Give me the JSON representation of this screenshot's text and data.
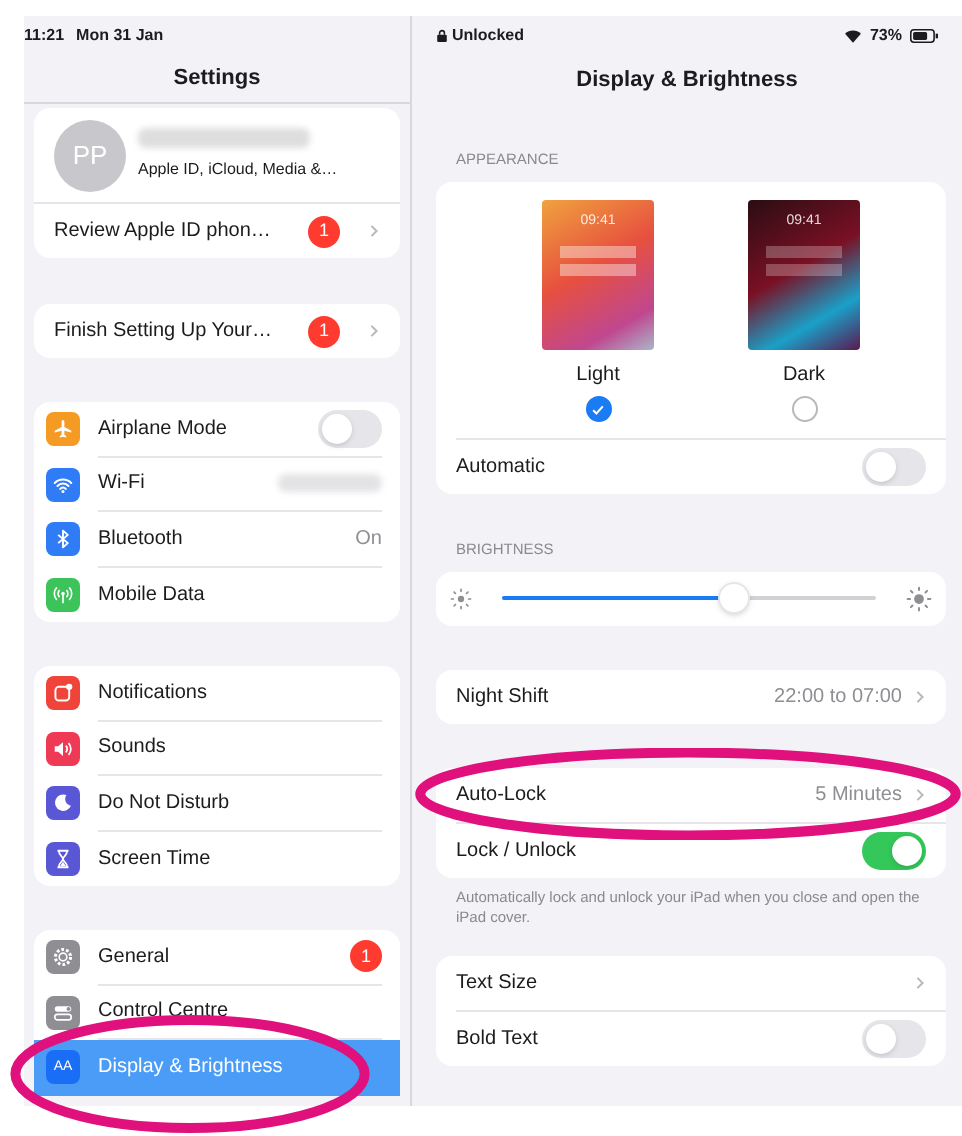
{
  "sidebar": {
    "status_time": "11:21",
    "status_date": "Mon 31 Jan",
    "title": "Settings",
    "profile": {
      "initials": "PP",
      "subtitle": "Apple ID, iCloud, Media &…",
      "alert": {
        "label": "Review Apple ID phon…",
        "badge": "1"
      }
    },
    "setup": {
      "label": "Finish Setting Up Your…",
      "badge": "1"
    },
    "groups": [
      [
        {
          "label": "Airplane Mode",
          "color": "#f59a23",
          "kind": "toggle",
          "on": false,
          "selected": false
        },
        {
          "label": "Wi-Fi",
          "color": "#2f7cf6",
          "kind": "hidden",
          "selected": false
        },
        {
          "label": "Bluetooth",
          "color": "#2f7cf6",
          "kind": "value",
          "value": "On",
          "selected": false
        },
        {
          "label": "Mobile Data",
          "color": "#3cc35a",
          "kind": "plain",
          "selected": false
        }
      ],
      [
        {
          "label": "Notifications",
          "color": "#f0433a",
          "kind": "plain",
          "selected": false
        },
        {
          "label": "Sounds",
          "color": "#ef3a55",
          "kind": "plain",
          "selected": false
        },
        {
          "label": "Do Not Disturb",
          "color": "#5a57d6",
          "kind": "plain",
          "selected": false
        },
        {
          "label": "Screen Time",
          "color": "#5a57d6",
          "kind": "plain",
          "selected": false
        }
      ],
      [
        {
          "label": "General",
          "color": "#8e8e93",
          "kind": "badge",
          "badge": "1",
          "selected": false
        },
        {
          "label": "Control Centre",
          "color": "#8e8e93",
          "kind": "plain",
          "selected": false
        },
        {
          "label": "Display & Brightness",
          "icon_text": "AA",
          "color": "#1a6ef5",
          "kind": "plain",
          "selected": true,
          "highlighted": true
        }
      ]
    ]
  },
  "detail": {
    "status_lock": "Unlocked",
    "battery_text": "73%",
    "title": "Display & Brightness",
    "appearance": {
      "header": "APPEARANCE",
      "options": [
        {
          "label": "Light",
          "time": "09:41",
          "selected": true
        },
        {
          "label": "Dark",
          "time": "09:41",
          "selected": false
        }
      ],
      "automatic": {
        "label": "Automatic",
        "on": false
      }
    },
    "brightness": {
      "header": "BRIGHTNESS",
      "level": 0.62
    },
    "groups": [
      {
        "rows": [
          {
            "label": "Night Shift",
            "kind": "value",
            "value": "22:00 to 07:00",
            "highlighted": false
          }
        ]
      },
      {
        "rows": [
          {
            "label": "Auto-Lock",
            "kind": "value",
            "value": "5 Minutes",
            "highlighted": true
          },
          {
            "label": "Lock / Unlock",
            "kind": "toggle",
            "on": true,
            "highlighted": false
          }
        ],
        "footer": "Automatically lock and unlock your iPad when you close and open the iPad cover."
      },
      {
        "rows": [
          {
            "label": "Text Size",
            "kind": "link",
            "highlighted": false
          },
          {
            "label": "Bold Text",
            "kind": "toggle",
            "on": false,
            "highlighted": false
          }
        ]
      }
    ]
  }
}
